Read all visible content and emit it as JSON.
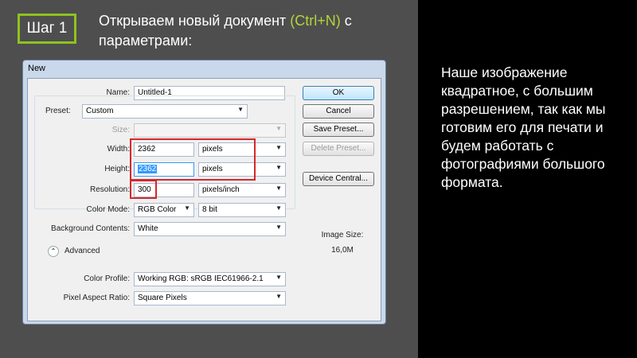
{
  "slide": {
    "step_label": "Шаг 1",
    "heading_prefix": "Открываем новый документ ",
    "heading_shortcut": "(Ctrl+N)",
    "heading_suffix": " с параметрами:",
    "side_text": "Наше изображение квадратное, с большим разрешением, так как мы готовим его для печати и будем работать с фотографиями большого формата."
  },
  "dialog": {
    "title": "New",
    "name_label": "Name:",
    "name_value": "Untitled-1",
    "preset_label": "Preset:",
    "preset_value": "Custom",
    "size_label": "Size:",
    "size_value": "",
    "width_label": "Width:",
    "width_value": "2362",
    "width_unit": "pixels",
    "height_label": "Height:",
    "height_value": "2362",
    "height_unit": "pixels",
    "resolution_label": "Resolution:",
    "resolution_value": "300",
    "resolution_unit": "pixels/inch",
    "color_mode_label": "Color Mode:",
    "color_mode_value": "RGB Color",
    "color_depth_value": "8 bit",
    "background_label": "Background Contents:",
    "background_value": "White",
    "advanced_label": "Advanced",
    "color_profile_label": "Color Profile:",
    "color_profile_value": "Working RGB:  sRGB IEC61966-2.1",
    "pixel_aspect_label": "Pixel Aspect Ratio:",
    "pixel_aspect_value": "Square Pixels",
    "buttons": {
      "ok": "OK",
      "cancel": "Cancel",
      "save_preset": "Save Preset...",
      "delete_preset": "Delete Preset...",
      "device_central": "Device Central..."
    },
    "image_size_label": "Image Size:",
    "image_size_value": "16,0M"
  },
  "colors": {
    "accent": "#8ec21f",
    "highlight": "#b5d43a",
    "annotation": "#d62828"
  }
}
